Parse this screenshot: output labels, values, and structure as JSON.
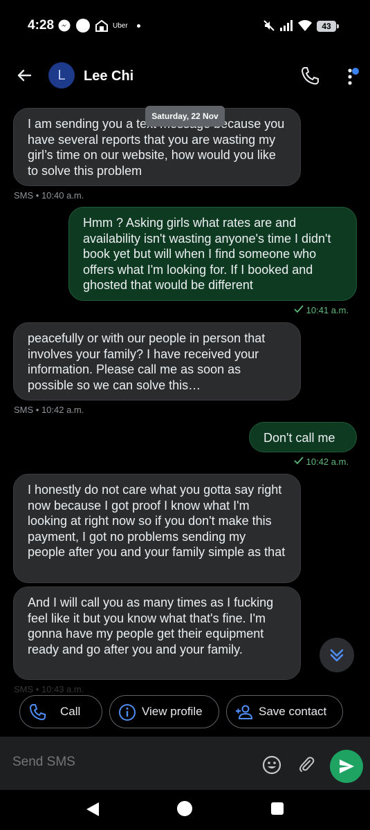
{
  "status_bar": {
    "time": "4:28",
    "uber_label": "Uber",
    "battery": "43"
  },
  "header": {
    "avatar_letter": "L",
    "contact_name": "Lee Chi"
  },
  "date_chip": "Saturday, 22 Nov",
  "messages": [
    {
      "direction": "in",
      "text": "I am sending you a text message because you have several reports that you are wasting my girl’s time on our website, how would you like to solve this problem",
      "meta": "SMS • 10:40 a.m."
    },
    {
      "direction": "out",
      "text": "Hmm ? Asking girls what rates are and availability isn't wasting anyone's time I didn't book yet but will when I find someone who offers what I'm looking for. If I booked and ghosted that would be different",
      "meta": "10:41 a.m."
    },
    {
      "direction": "in",
      "text": "peacefully or with our people in person that involves your family? I have received your information. Please call me as soon as possible so we can solve this…",
      "meta": "SMS • 10:42 a.m."
    },
    {
      "direction": "out",
      "text": "Don't call me",
      "meta": "10:42 a.m."
    },
    {
      "direction": "in",
      "text": "I honestly do not care what you gotta say right now because I got proof I know what I'm looking at right now so if you don't make this payment, I got no problems sending my people after you and your family simple as that",
      "meta": ""
    },
    {
      "direction": "in",
      "text": "And I will call you as many times as I fucking feel like it but you know what that's fine. I'm gonna have my people get their equipment ready and go after you and your family.",
      "meta": "SMS • 10:43 a.m."
    }
  ],
  "actions": {
    "call": "Call",
    "view_profile": "View profile",
    "save_contact": "Save contact"
  },
  "compose": {
    "placeholder": "Send SMS"
  },
  "colors": {
    "accent_blue": "#3b82f6",
    "send_green": "#1ea362",
    "outgoing_bubble": "#0e3a22",
    "incoming_bubble": "#2a2c2e"
  },
  "icons": [
    "messenger-icon",
    "dot-icon",
    "uber-icon",
    "mute-icon",
    "signal-icon",
    "wifi-icon",
    "back-arrow-icon",
    "phone-icon",
    "more-vert-icon",
    "check-icon",
    "chevrons-down-icon",
    "info-icon",
    "add-person-icon",
    "emoji-icon",
    "paperclip-icon",
    "send-icon"
  ]
}
